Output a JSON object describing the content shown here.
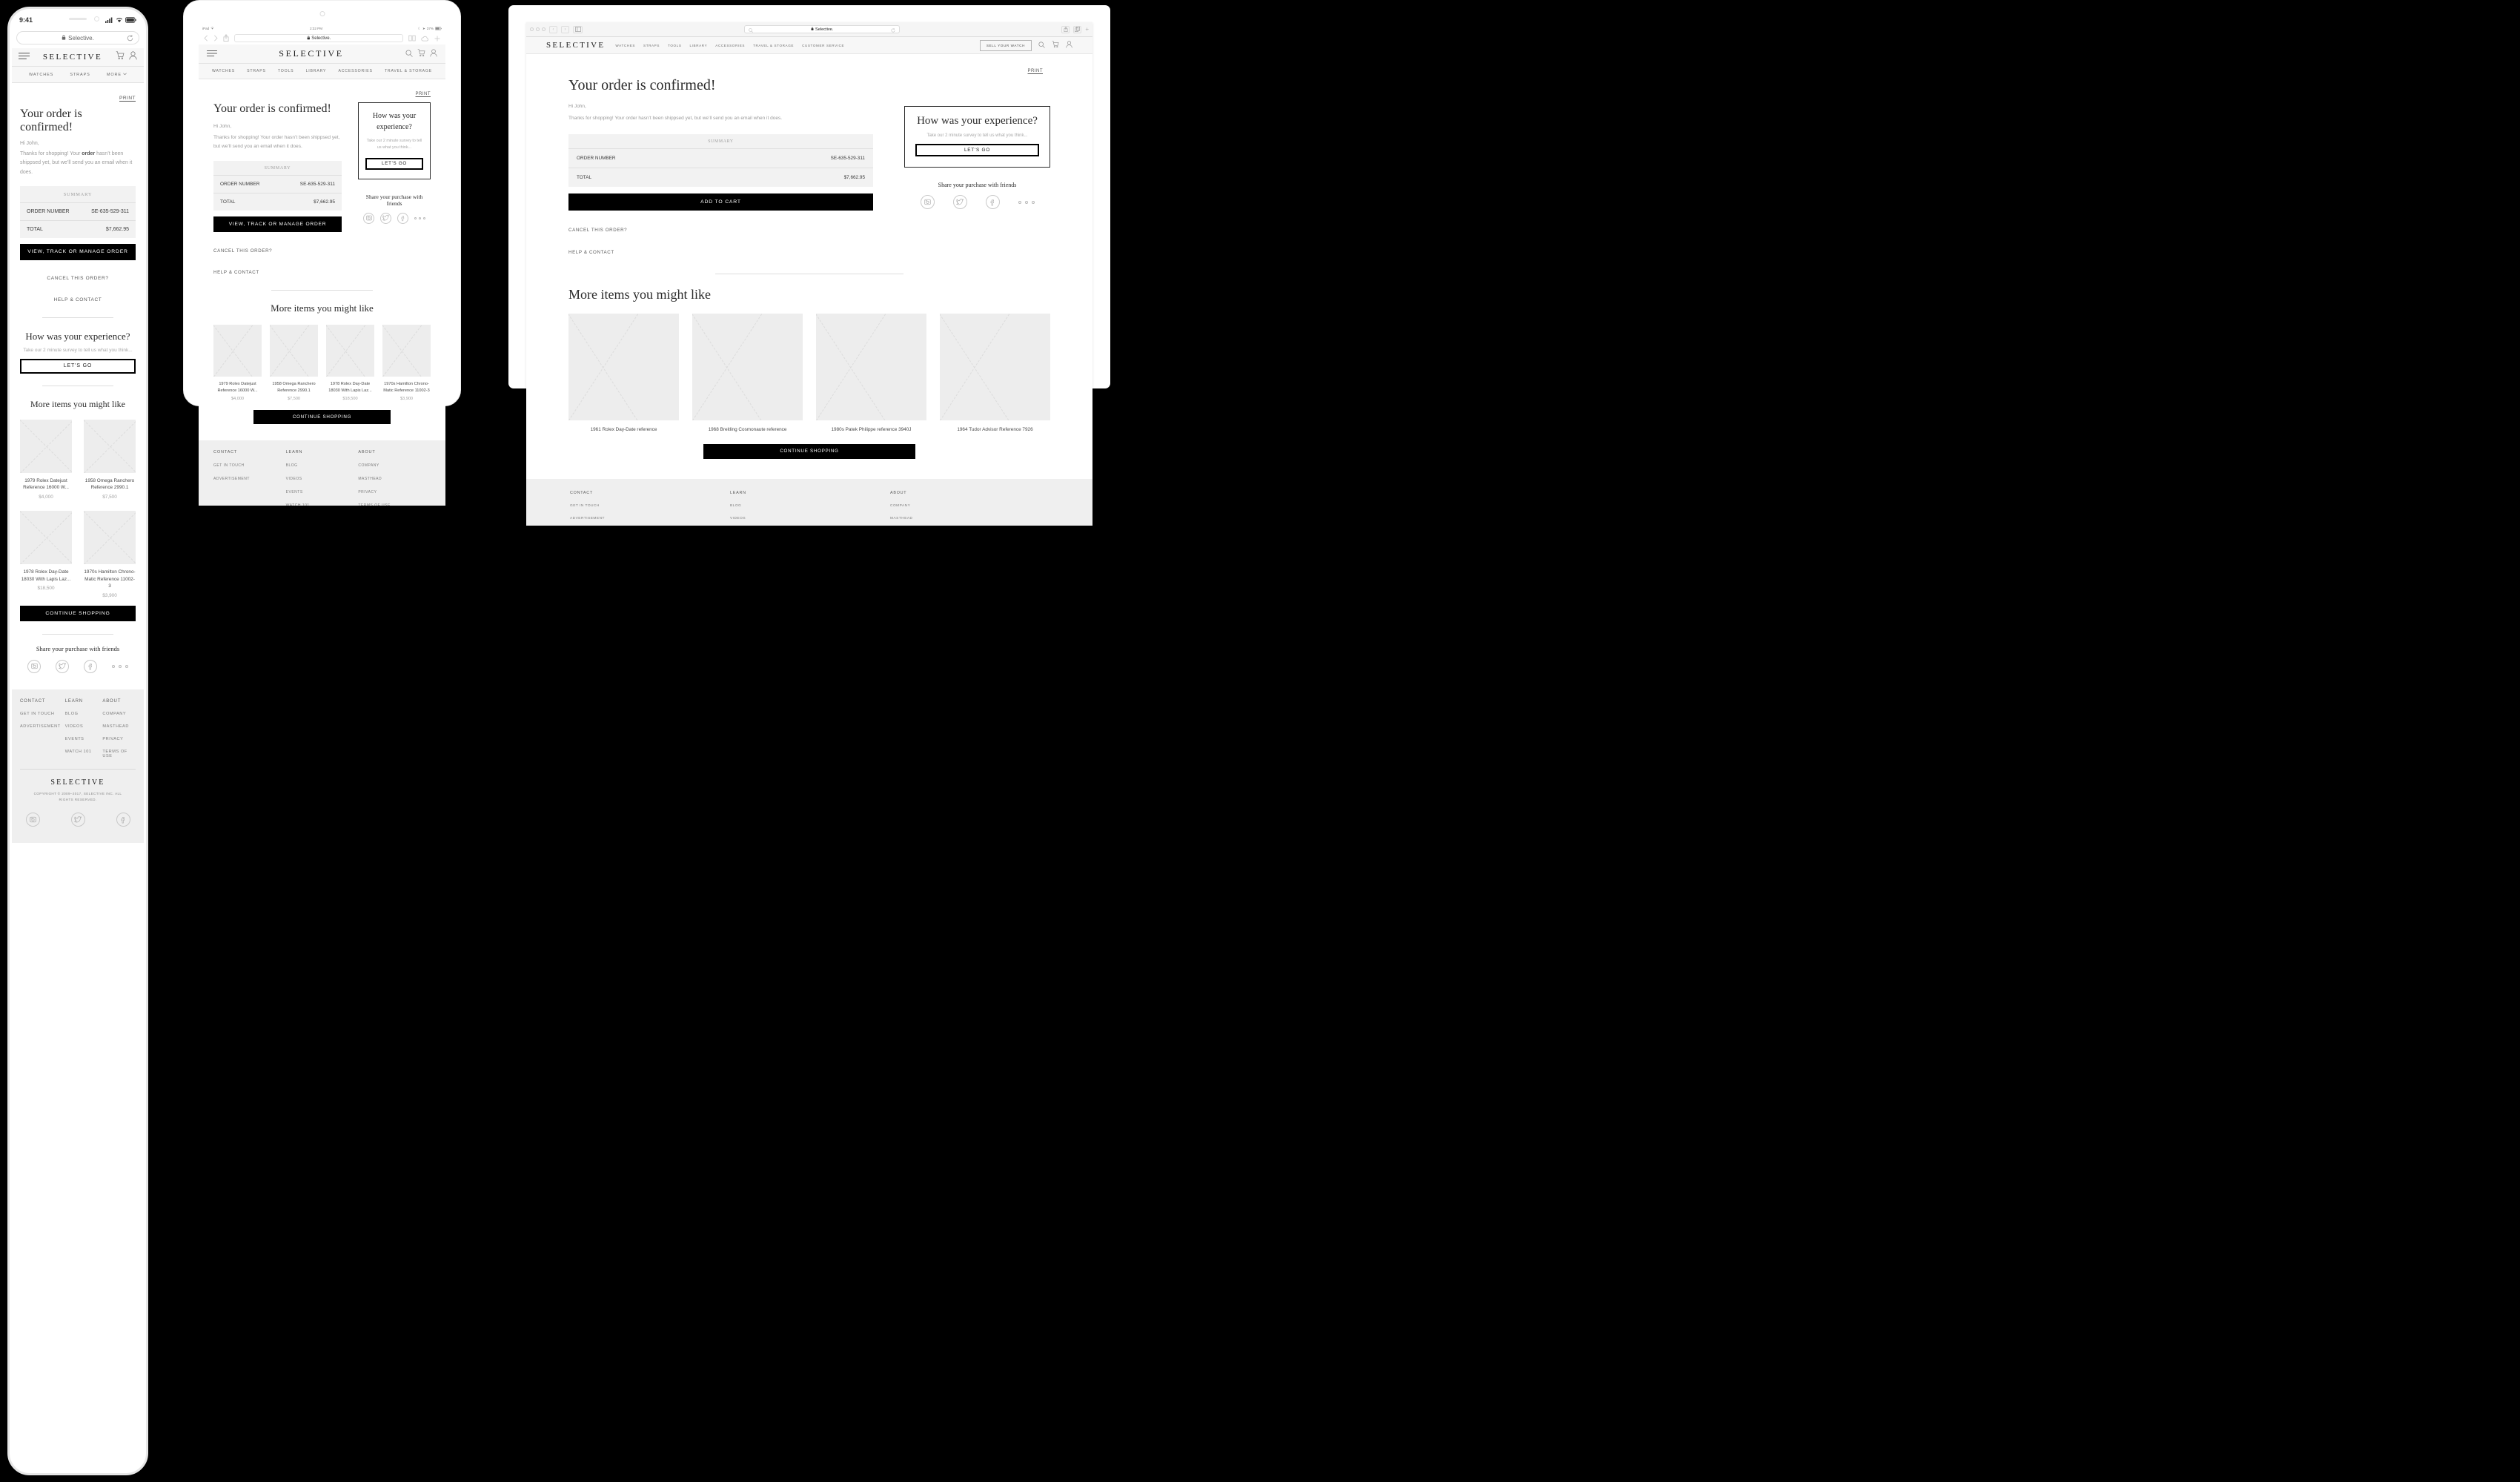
{
  "site": {
    "brand": "SELECTIVE",
    "url": "Selective.",
    "print_label": "PRINT",
    "heading": "Your order is confirmed!",
    "greeting": "Hi John,",
    "body_pre": "Thanks for shopping! Your ",
    "body_link": "order",
    "body_post": " hasn’t been shippsed yet, but we’ll send you an email when it does.",
    "summary": {
      "title": "SUMMARY",
      "rows": [
        {
          "label": "ORDER NUMBER",
          "value": "SE-635-529-311"
        },
        {
          "label": "TOTAL",
          "value": "$7,662.95"
        }
      ]
    },
    "primary_cta_mobile": "VIEW, TRACK OR MANAGE ORDER",
    "primary_cta_desktop": "ADD TO CART",
    "links": [
      "CANCEL THIS ORDER?",
      "HELP & CONTACT"
    ],
    "survey": {
      "heading": "How was your experience?",
      "subtext": "Take our 2 minute survey to tell us what you think...",
      "button": "LET'S GO"
    },
    "share": {
      "heading": "Share your purchase with friends",
      "icons": [
        "instagram-icon",
        "twitter-icon",
        "facebook-icon"
      ],
      "more": "more-dots-icon"
    },
    "more_items_heading": "More items you might like",
    "continue_label": "CONTINUE SHOPPING",
    "nav_mobile": [
      "WATCHES",
      "STRAPS",
      "MORE"
    ],
    "nav_tablet": [
      "WATCHES",
      "STRAPS",
      "TOOLS",
      "LIBRARY",
      "ACCESSORIES",
      "TRAVEL & STORAGE"
    ],
    "nav_desktop": [
      "WATCHES",
      "STRAPS",
      "TOOLS",
      "LIBRARY",
      "ACCESSORIES",
      "TRAVEL & STORAGE",
      "CUSTOMER SERVICE"
    ],
    "sell_button": "SELL YOUR WATCH",
    "footer": {
      "columns": [
        {
          "title": "CONTACT",
          "links": [
            "GET IN TOUCH",
            "ADVERTISEMENT"
          ]
        },
        {
          "title": "LEARN",
          "links": [
            "BLOG",
            "VIDEOS",
            "EVENTS",
            "WATCH 101"
          ]
        },
        {
          "title": "ABOUT",
          "links": [
            "COMPANY",
            "MASTHEAD",
            "PRIVACY",
            "TERMS OF USE"
          ]
        }
      ],
      "brand": "SELECTIVE",
      "copyright": "COPYRIGHT © 2009–2017, SELECTIVE INC. ALL RIGHTS RESERVED."
    }
  },
  "products_small": [
    {
      "title": "1979 Rolex Datejust Reference 16000 W...",
      "price": "$4,000"
    },
    {
      "title": "1958 Omega Ranchero Reference 2990.1",
      "price": "$7,500"
    },
    {
      "title": "1978 Rolex Day-Date 18030 With Lapis Laz...",
      "price": "$18,500"
    },
    {
      "title": "1970s Hamilton Chrono-Matic Reference 11002-3",
      "price": "$3,900"
    }
  ],
  "products_desktop": [
    {
      "title": "1961 Rolex Day-Date reference"
    },
    {
      "title": "1968 Breitling Cosmonaute reference"
    },
    {
      "title": "1980s Patek Philippe reference 3940J"
    },
    {
      "title": "1964 Tudor Advisor Reference 7926"
    }
  ],
  "phone": {
    "status_time": "9:41",
    "icons": [
      "cellular-signal-icon",
      "wifi-icon",
      "battery-icon"
    ],
    "lock": "lock-icon",
    "reload": "reload-icon",
    "menu": "hamburger-menu-icon",
    "cart": "cart-icon",
    "account": "account-icon",
    "chevron": "chevron-down-icon"
  },
  "tablet": {
    "device_label": "iPad",
    "wifi": "wifi-icon",
    "time": "2:32 PM",
    "battery_pct": "37%",
    "back": "back-arrow-icon",
    "forward": "forward-arrow-icon",
    "share": "share-icon",
    "bookmarks": "bookmarks-icon",
    "cloud": "icloud-tabs-icon",
    "newtab": "new-tab-icon",
    "search": "search-icon",
    "cart": "cart-icon",
    "account": "account-icon",
    "menu": "hamburger-menu-icon"
  },
  "desktop": {
    "search": "search-icon",
    "cart": "cart-icon",
    "account": "account-icon",
    "sidebar": "sidebar-toggle-icon",
    "share": "share-icon",
    "tabs": "tabs-icon",
    "newtab": "new-tab-icon",
    "reload": "reload-icon",
    "lock": "lock-icon"
  },
  "colors": {
    "page_bg": "#000000",
    "chrome_bg": "#f5f5f5",
    "nav_bg": "#f7f7f7",
    "footer_bg": "#efefef",
    "placeholder": "#ededed",
    "accent_black": "#000000",
    "muted_text": "#9a9a9a"
  }
}
